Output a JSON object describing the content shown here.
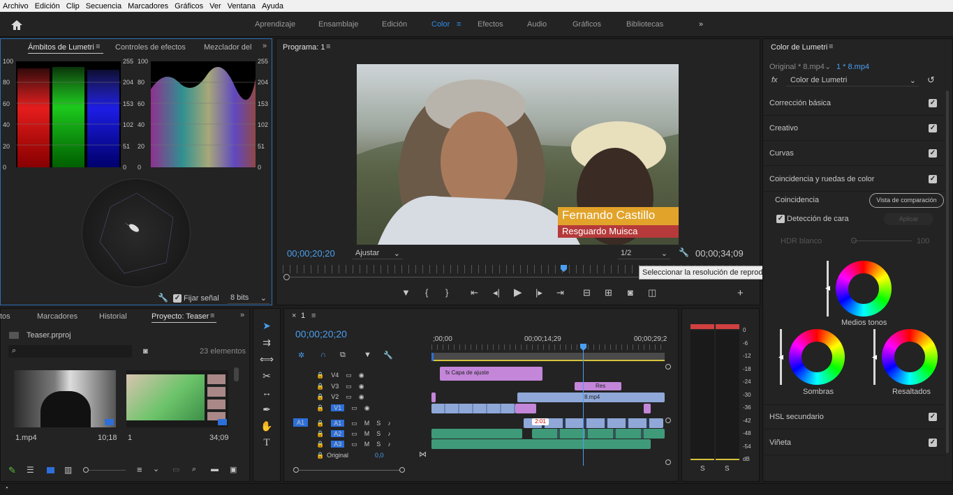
{
  "menu": [
    "Archivo",
    "Edición",
    "Clip",
    "Secuencia",
    "Marcadores",
    "Gráficos",
    "Ver",
    "Ventana",
    "Ayuda"
  ],
  "workspaces": [
    "Aprendizaje",
    "Ensamblaje",
    "Edición",
    "Color",
    "Efectos",
    "Audio",
    "Gráficos",
    "Bibliotecas"
  ],
  "active_workspace": "Color",
  "scopes_panel": {
    "tabs": [
      "Ámbitos de Lumetri",
      "Controles de efectos",
      "Mezclador del"
    ],
    "left_axis": [
      "100",
      "80",
      "60",
      "40",
      "20",
      "0"
    ],
    "right_axis": [
      "255",
      "204",
      "153",
      "102",
      "51",
      "0"
    ],
    "fix_signal": "Fijar señal",
    "bits": "8 bits"
  },
  "program": {
    "title": "Programa: 1",
    "timecode": "00;00;20;20",
    "fit": "Ajustar",
    "resolution": "1/2",
    "duration": "00;00;34;09",
    "tooltip": "Seleccionar la resolución de reproducción",
    "lower_third_name": "Fernando Castillo",
    "lower_third_org": "Resguardo Muisca"
  },
  "project_panel": {
    "tabs": [
      "tos",
      "Marcadores",
      "Historial",
      "Proyecto: Teaser"
    ],
    "file": "Teaser.prproj",
    "count": "23 elementos",
    "items": [
      {
        "name": "1.mp4",
        "duration": "10;18"
      },
      {
        "name": "1",
        "duration": "34;09"
      }
    ]
  },
  "timeline": {
    "tab": "1",
    "timecode": "00;00;20;20",
    "ruler": [
      ";00;00",
      "00;00;14;29",
      "00;00;29;2"
    ],
    "video_tracks": [
      "V4",
      "V3",
      "V2",
      "V1"
    ],
    "audio_tracks": [
      "A1",
      "A2",
      "A3"
    ],
    "source_v": "V1",
    "source_a": "A1",
    "original_label": "Original",
    "original_value": "0,0",
    "clips": {
      "adjustment": "Capa de ajuste",
      "res": "Res",
      "mp4": "8.mp4",
      "audio_marker": "2:01"
    }
  },
  "meter_scale": [
    "0",
    "-6",
    "-12",
    "-18",
    "-24",
    "-30",
    "-36",
    "-42",
    "-48",
    "-54",
    "dB"
  ],
  "meter_solo": [
    "S",
    "S"
  ],
  "lumetri": {
    "title": "Color de Lumetri",
    "source": "Original * 8.mp4",
    "sequence": "1 * 8.mp4",
    "effect": "Color de Lumetri",
    "sections": [
      "Corrección básica",
      "Creativo",
      "Curvas",
      "Coincidencia y ruedas de color"
    ],
    "match_label": "Coincidencia",
    "compare_button": "Vista de comparación",
    "face_detect": "Detección de cara",
    "apply": "Aplicar",
    "hdr_label": "HDR blanco",
    "hdr_value": "100",
    "wheels": [
      "Medios tonos",
      "Sombras",
      "Resaltados"
    ],
    "bottom_sections": [
      "HSL secundario",
      "Viñeta"
    ]
  },
  "colors": {
    "accent": "#2d8ceb",
    "adjustment_clip": "#c486d9",
    "video_clip": "#8fa8d8",
    "audio_clip": "#3f9a7a",
    "lower_third_gold": "#e2a32a",
    "lower_third_red": "#b63a3a"
  }
}
